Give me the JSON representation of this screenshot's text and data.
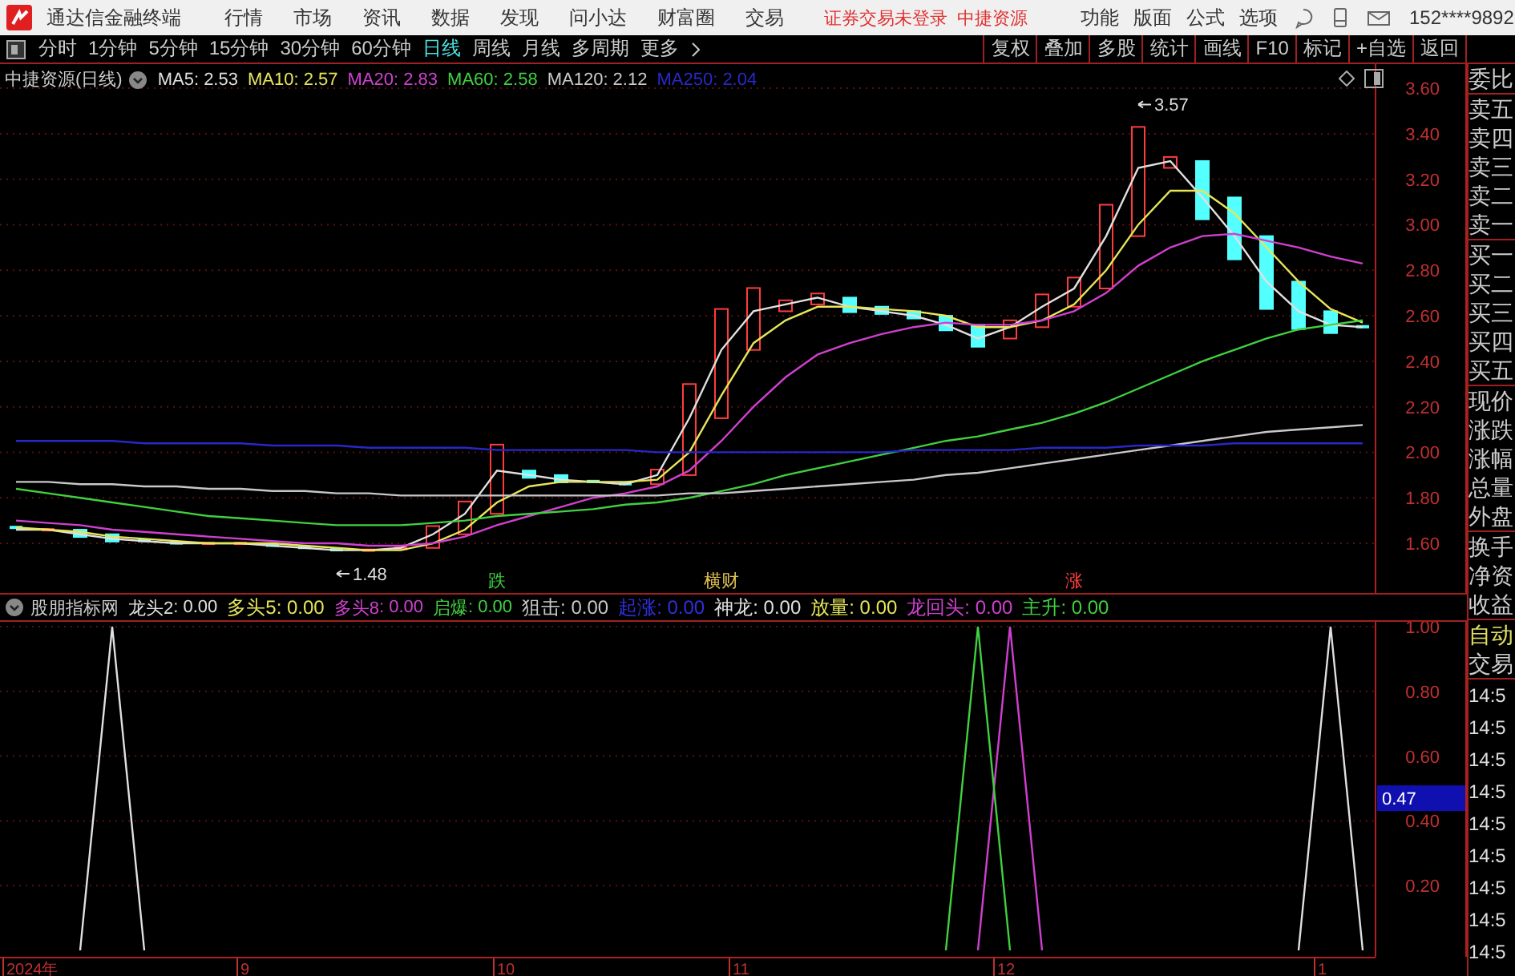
{
  "title_bar": {
    "app_name": "通达信金融终端",
    "menus": [
      "行情",
      "市场",
      "资讯",
      "数据",
      "发现",
      "问小达",
      "财富圈",
      "交易"
    ],
    "notices": [
      "证券交易未登录",
      "中捷资源"
    ],
    "tools": [
      "功能",
      "版面",
      "公式",
      "选项"
    ],
    "account": "152****9892"
  },
  "period_bar": {
    "periods": [
      {
        "label": "分时",
        "selected": false
      },
      {
        "label": "1分钟",
        "selected": false
      },
      {
        "label": "5分钟",
        "selected": false
      },
      {
        "label": "15分钟",
        "selected": false
      },
      {
        "label": "30分钟",
        "selected": false
      },
      {
        "label": "60分钟",
        "selected": false
      },
      {
        "label": "日线",
        "selected": true
      },
      {
        "label": "周线",
        "selected": false
      },
      {
        "label": "月线",
        "selected": false
      },
      {
        "label": "多周期",
        "selected": false
      },
      {
        "label": "更多",
        "selected": false
      }
    ],
    "actions": [
      "复权",
      "叠加",
      "多股",
      "统计",
      "画线",
      "F10",
      "标记",
      "+自选",
      "返回"
    ]
  },
  "main_chart": {
    "title": "中捷资源(日线)",
    "legend": [
      {
        "kind": "series",
        "value": ": 2.53"
      },
      {
        "kind": "series",
        "value": ": 2.57"
      },
      {
        "kind": "series",
        "value": ": 2.83"
      },
      {
        "kind": "series",
        "value": ": 2.58"
      },
      {
        "kind": "series",
        "value": ": 2.12"
      },
      {
        "kind": "series",
        "value": ": 2.04"
      }
    ],
    "marks": [
      {
        "kind": "high",
        "text": "3.57"
      },
      {
        "kind": "low",
        "text": "1.48"
      },
      {
        "kind": "signal",
        "text": "跌",
        "color": "#40d040"
      },
      {
        "kind": "signal",
        "text": "横财",
        "color": "#e0c050"
      },
      {
        "kind": "signal",
        "text": "涨",
        "color": "#ff4040"
      }
    ],
    "chart_data": {
      "type": "line",
      "grid": true,
      "ylim": [
        1.382,
        3.706
      ],
      "yticks": [
        {
          "value": 1.6,
          "label": "1.60"
        },
        {
          "value": 1.8,
          "label": "1.80"
        },
        {
          "value": 2.0,
          "label": "2.00"
        },
        {
          "value": 2.2,
          "label": "2.20"
        },
        {
          "value": 2.4,
          "label": "2.40"
        },
        {
          "value": 2.6,
          "label": "2.60"
        },
        {
          "value": 2.8,
          "label": "2.80"
        },
        {
          "value": 3.0,
          "label": "3.00"
        },
        {
          "value": 3.2,
          "label": "3.20"
        },
        {
          "value": 3.4,
          "label": "3.40"
        },
        {
          "value": 3.6,
          "label": "3.60"
        }
      ],
      "series": [
        {
          "name": "MA5",
          "color": "#e0e0e0",
          "values": [
            1.66,
            1.66,
            1.64,
            1.62,
            1.61,
            1.6,
            1.6,
            1.6,
            1.59,
            1.58,
            1.57,
            1.57,
            1.58,
            1.64,
            1.73,
            1.92,
            1.9,
            1.88,
            1.87,
            1.86,
            1.9,
            2.15,
            2.45,
            2.62,
            2.65,
            2.68,
            2.64,
            2.62,
            2.6,
            2.56,
            2.5,
            2.55,
            2.64,
            2.72,
            2.95,
            3.25,
            3.28,
            3.12,
            2.95,
            2.75,
            2.62,
            2.56,
            2.55
          ]
        },
        {
          "name": "MA10",
          "color": "#e6e65a",
          "values": [
            1.67,
            1.66,
            1.65,
            1.63,
            1.62,
            1.61,
            1.6,
            1.6,
            1.6,
            1.59,
            1.58,
            1.57,
            1.57,
            1.6,
            1.66,
            1.78,
            1.85,
            1.87,
            1.87,
            1.87,
            1.88,
            2.0,
            2.25,
            2.48,
            2.58,
            2.64,
            2.64,
            2.63,
            2.62,
            2.6,
            2.55,
            2.55,
            2.58,
            2.65,
            2.8,
            3.0,
            3.15,
            3.15,
            3.05,
            2.9,
            2.75,
            2.63,
            2.57
          ]
        },
        {
          "name": "MA20",
          "color": "#d040d0",
          "values": [
            1.7,
            1.69,
            1.68,
            1.66,
            1.65,
            1.64,
            1.63,
            1.62,
            1.61,
            1.6,
            1.6,
            1.59,
            1.59,
            1.6,
            1.63,
            1.68,
            1.72,
            1.76,
            1.8,
            1.82,
            1.85,
            1.92,
            2.05,
            2.2,
            2.33,
            2.43,
            2.48,
            2.52,
            2.55,
            2.57,
            2.56,
            2.56,
            2.58,
            2.62,
            2.7,
            2.82,
            2.9,
            2.95,
            2.96,
            2.93,
            2.9,
            2.86,
            2.83
          ]
        },
        {
          "name": "MA60",
          "color": "#40d040",
          "values": [
            1.84,
            1.82,
            1.8,
            1.78,
            1.76,
            1.74,
            1.72,
            1.71,
            1.7,
            1.69,
            1.68,
            1.68,
            1.68,
            1.69,
            1.7,
            1.72,
            1.73,
            1.74,
            1.75,
            1.77,
            1.78,
            1.8,
            1.83,
            1.86,
            1.9,
            1.93,
            1.96,
            1.99,
            2.02,
            2.05,
            2.07,
            2.1,
            2.13,
            2.17,
            2.22,
            2.28,
            2.34,
            2.4,
            2.45,
            2.5,
            2.54,
            2.56,
            2.58
          ]
        },
        {
          "name": "MA120",
          "color": "#c8c8c8",
          "values": [
            1.87,
            1.87,
            1.86,
            1.86,
            1.85,
            1.85,
            1.84,
            1.84,
            1.83,
            1.83,
            1.82,
            1.82,
            1.81,
            1.81,
            1.81,
            1.81,
            1.81,
            1.81,
            1.81,
            1.81,
            1.81,
            1.82,
            1.82,
            1.83,
            1.84,
            1.85,
            1.86,
            1.87,
            1.88,
            1.9,
            1.91,
            1.93,
            1.95,
            1.97,
            1.99,
            2.01,
            2.03,
            2.05,
            2.07,
            2.09,
            2.1,
            2.11,
            2.12
          ]
        },
        {
          "name": "MA250",
          "color": "#2828c8",
          "values": [
            2.05,
            2.05,
            2.05,
            2.05,
            2.04,
            2.04,
            2.04,
            2.04,
            2.03,
            2.03,
            2.03,
            2.02,
            2.02,
            2.02,
            2.02,
            2.01,
            2.01,
            2.01,
            2.01,
            2.01,
            2.0,
            2.0,
            2.0,
            2.0,
            2.0,
            2.0,
            2.0,
            2.0,
            2.01,
            2.01,
            2.01,
            2.01,
            2.02,
            2.02,
            2.02,
            2.03,
            2.03,
            2.03,
            2.04,
            2.04,
            2.04,
            2.04,
            2.04
          ]
        }
      ]
    }
  },
  "indicator": {
    "title": "股朋指标网",
    "legend": [
      {
        "kind": "series",
        "value": ": 0.00"
      },
      {
        "kind": "plain",
        "label": "多头5: 0.00",
        "color": "#e6e65a"
      },
      {
        "kind": "series",
        "value": ": 0.00"
      },
      {
        "kind": "series",
        "value": ": 0.00"
      },
      {
        "kind": "plain",
        "label": "狙击: 0.00",
        "color": "#c8c8c8"
      },
      {
        "kind": "plain",
        "label": "起涨: 0.00",
        "color": "#3030e0"
      },
      {
        "kind": "plain",
        "label": "神龙: 0.00",
        "color": "#e0e0e0"
      },
      {
        "kind": "plain",
        "label": "放量: 0.00",
        "color": "#e6e65a"
      },
      {
        "kind": "plain",
        "label": "龙回头: 0.00",
        "color": "#d040d0"
      },
      {
        "kind": "plain",
        "label": "主升: 0.00",
        "color": "#40d040"
      }
    ],
    "axis_marker": "0.47",
    "chart_data": {
      "type": "line",
      "grid": true,
      "ylim": [
        -0.02,
        1.015
      ],
      "yticks": [
        {
          "value": 0.2,
          "label": "0.20"
        },
        {
          "value": 0.4,
          "label": "0.40"
        },
        {
          "value": 0.6,
          "label": "0.60"
        },
        {
          "value": 0.8,
          "label": "0.80"
        },
        {
          "value": 1.0,
          "label": "1.00"
        }
      ],
      "series": [
        {
          "name": "龙头2",
          "color": "#e0e0e0",
          "values": [
            null,
            null,
            0,
            1,
            0,
            null,
            null,
            null,
            null,
            null,
            null,
            null,
            null,
            null,
            null,
            null,
            null,
            null,
            null,
            null,
            null,
            null,
            null,
            null,
            null,
            null,
            null,
            null,
            null,
            null,
            null,
            null,
            null,
            null,
            null,
            null,
            null,
            null,
            null,
            null,
            0,
            1,
            0
          ]
        },
        {
          "name": "多头8",
          "color": "#d040d0",
          "values": [
            null,
            null,
            null,
            null,
            null,
            null,
            null,
            null,
            null,
            null,
            null,
            null,
            null,
            null,
            null,
            null,
            null,
            null,
            null,
            null,
            null,
            null,
            null,
            null,
            null,
            null,
            null,
            null,
            null,
            null,
            0,
            1,
            0,
            null,
            null,
            null,
            null,
            null,
            null,
            null,
            null,
            null,
            null
          ]
        },
        {
          "name": "启爆",
          "color": "#40d040",
          "values": [
            null,
            null,
            null,
            null,
            null,
            null,
            null,
            null,
            null,
            null,
            null,
            null,
            null,
            null,
            null,
            null,
            null,
            null,
            null,
            null,
            null,
            null,
            null,
            null,
            null,
            null,
            null,
            null,
            null,
            0,
            1,
            0,
            null,
            null,
            null,
            null,
            null,
            null,
            null,
            null,
            null,
            null,
            null
          ]
        }
      ]
    }
  },
  "date_axis": {
    "labels": [
      "2024年",
      "9",
      "10",
      "11",
      "12",
      "1"
    ]
  },
  "side_panel": {
    "groups": [
      [
        "委比"
      ],
      [
        "卖五",
        "卖四",
        "卖三",
        "卖二",
        "卖一"
      ],
      [
        "买一",
        "买二",
        "买三",
        "买四",
        "买五"
      ],
      [
        "现价",
        "涨跌",
        "涨幅",
        "总量",
        "外盘"
      ],
      [
        "换手",
        "净资",
        "收益"
      ]
    ],
    "auto_label": "自动",
    "trade_label": "交易",
    "times": [
      "14:5",
      "14:5",
      "14:5",
      "14:5",
      "14:5",
      "14:5",
      "14:5",
      "14:5",
      "14:5"
    ]
  }
}
